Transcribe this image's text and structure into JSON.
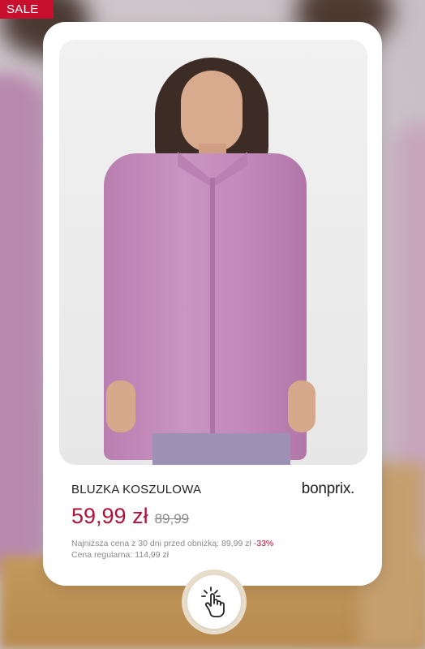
{
  "badge": {
    "label": "SALE"
  },
  "product": {
    "name": "BLUZKA KOSZULOWA",
    "brand": "bonprix.",
    "price_current": "59,99 zł",
    "price_old": "89,99",
    "lowest_price_label": "Najniższa cena z 30 dni przed obniżką: 89,99 zł",
    "discount": "-33%",
    "regular_price_label": "Cena regularna: 114,99 zł"
  },
  "cta": {
    "icon": "tap-hand-icon"
  },
  "colors": {
    "sale_red": "#c8102e",
    "price_red": "#b0123a",
    "shirt_pink": "#c48bbd"
  }
}
